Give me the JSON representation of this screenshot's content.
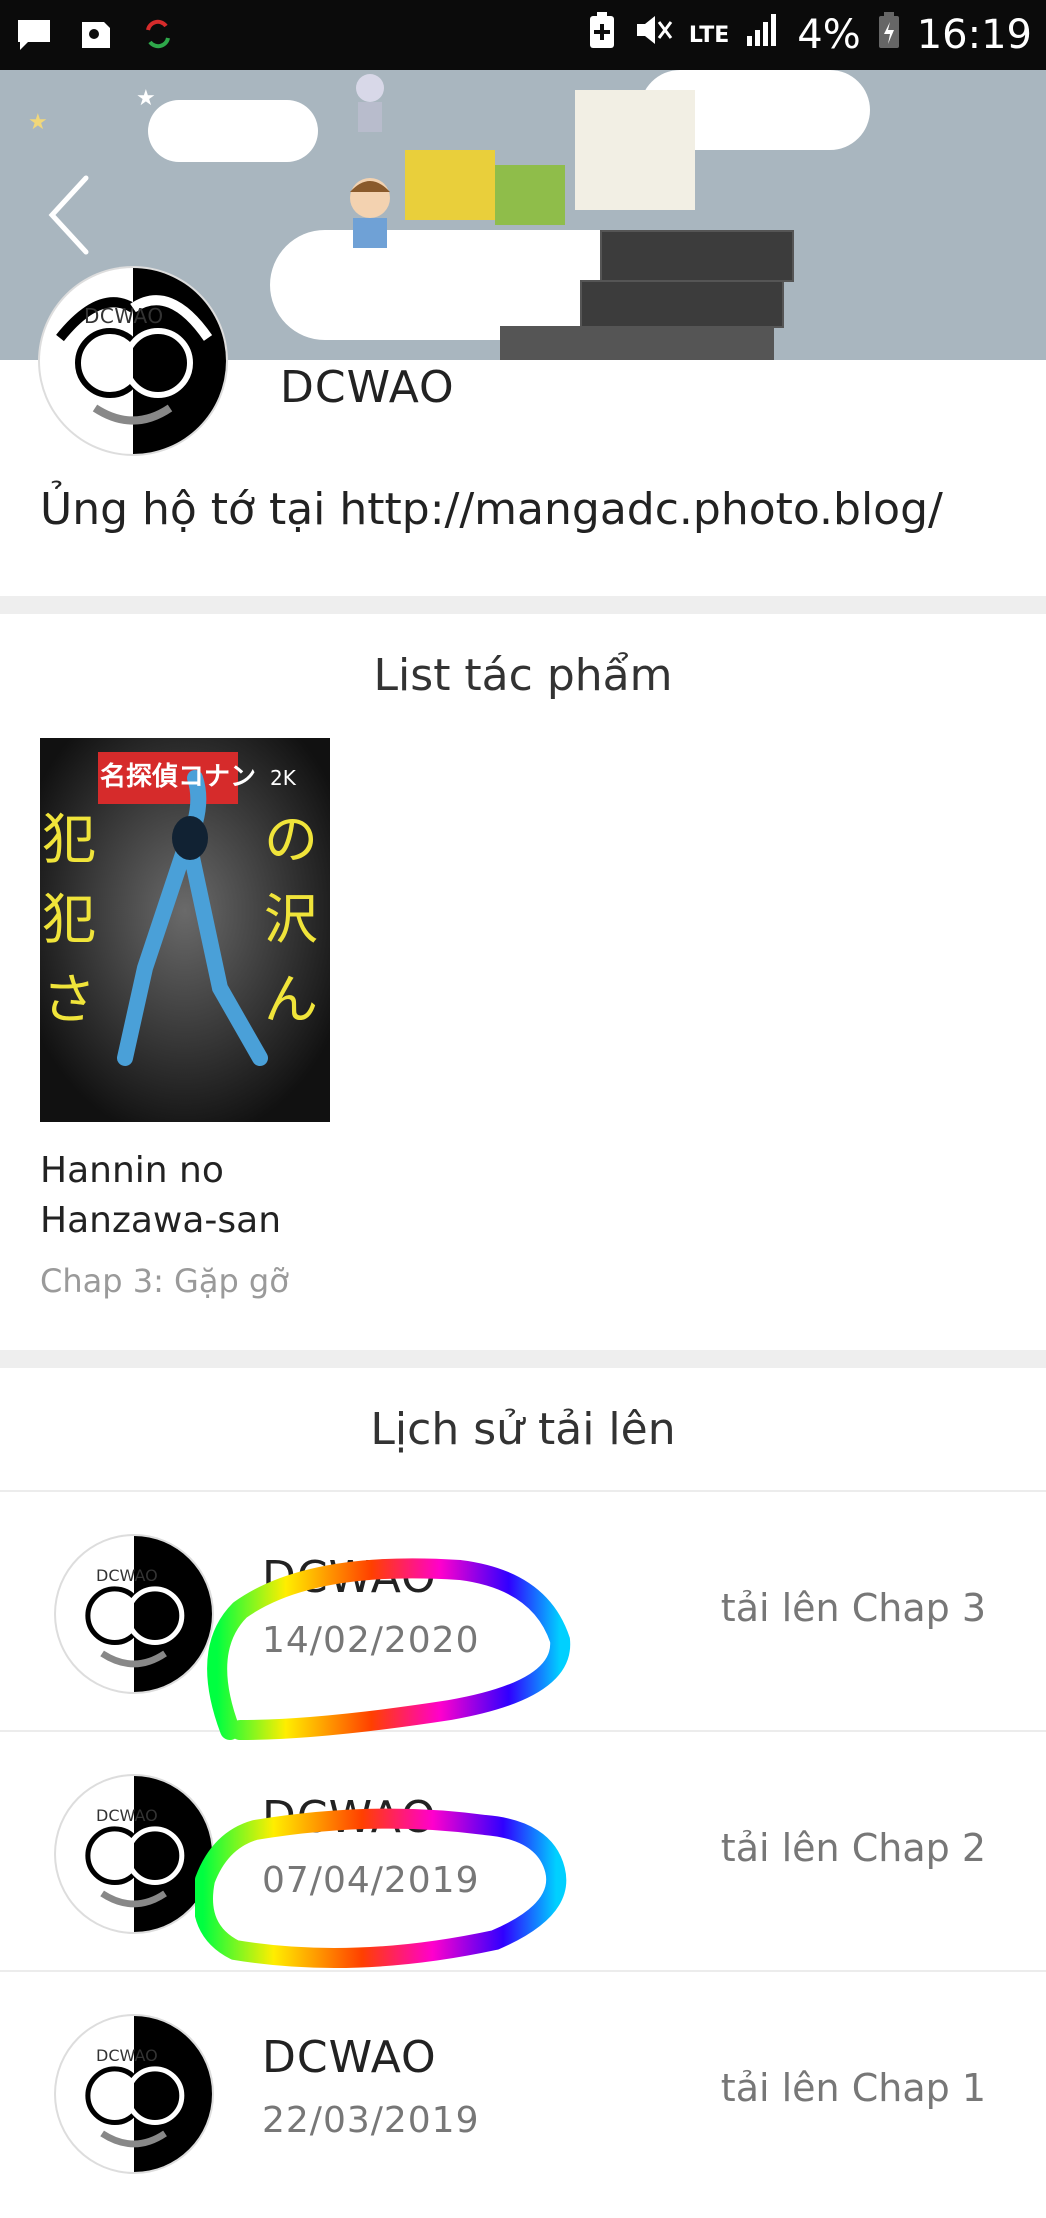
{
  "status_bar": {
    "battery": "4%",
    "time": "16:19",
    "network": "LTE"
  },
  "profile": {
    "avatar_text": "DCWAO",
    "name": "DCWAO",
    "bio": "Ủng hộ tớ tại http://mangadc.photo.blog/"
  },
  "works": {
    "title": "List tác phẩm",
    "items": [
      {
        "cover_brand": "名探偵コナン",
        "cover_badge": "2K",
        "title_line1": "Hannin no",
        "title_line2": "Hanzawa-san",
        "latest_chapter": "Chap 3: Gặp gỡ"
      }
    ]
  },
  "history": {
    "title": "Lịch sử tải lên",
    "items": [
      {
        "avatar_text": "DCWAO",
        "name": "DCWAO",
        "date": "14/02/2020",
        "action": "tải lên Chap 3"
      },
      {
        "avatar_text": "DCWAO",
        "name": "DCWAO",
        "date": "07/04/2019",
        "action": "tải lên Chap 2"
      },
      {
        "avatar_text": "DCWAO",
        "name": "DCWAO",
        "date": "22/03/2019",
        "action": "tải lên Chap 1"
      }
    ]
  },
  "colors": {
    "status_bar_bg": "#0b0b0b",
    "banner_bg": "#a9b6bf",
    "separator": "#eeeeee",
    "muted_text": "#777777"
  }
}
